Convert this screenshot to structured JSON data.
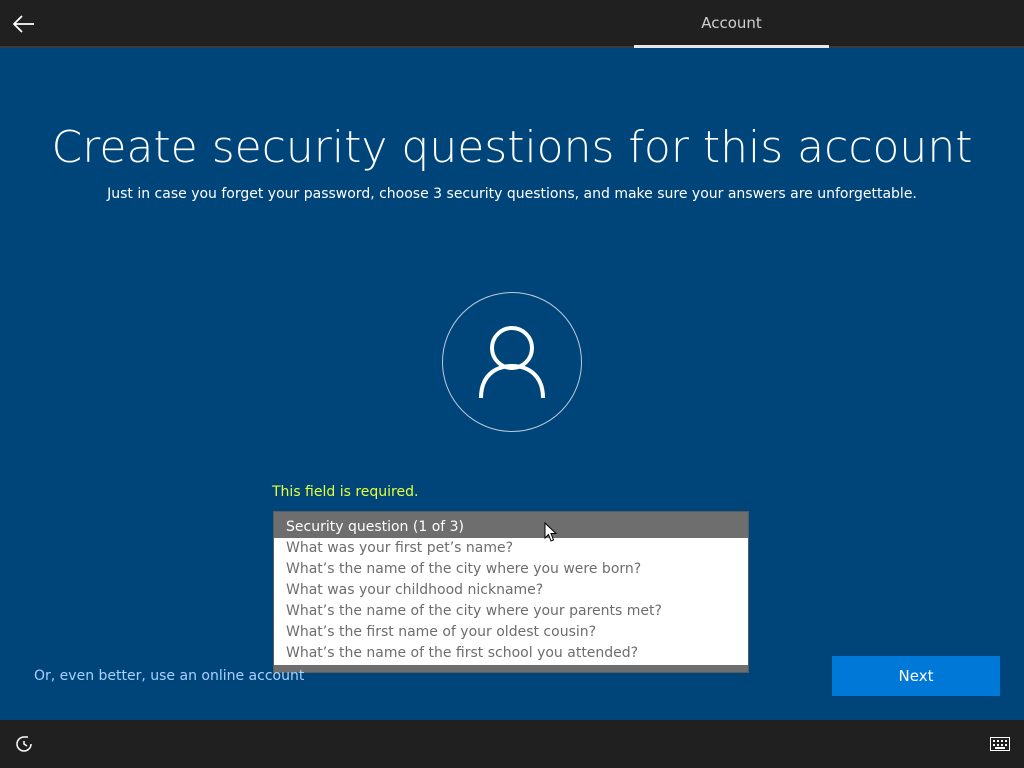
{
  "header": {
    "tab_label": "Account",
    "back_icon": "arrow-left-icon"
  },
  "main": {
    "title": "Create security questions for this account",
    "subtitle": "Just in case you forget your password, choose 3 security questions, and make sure your answers are unforgettable.",
    "avatar_icon": "user-icon",
    "error_text": "This field is required.",
    "dropdown": {
      "selected": "Security question (1 of 3)",
      "options": [
        "What was your first pet’s name?",
        "What’s the name of the city where you were born?",
        "What was your childhood nickname?",
        "What’s the name of the city where your parents met?",
        "What’s the first name of your oldest cousin?",
        "What’s the name of the first school you attended?"
      ]
    }
  },
  "footer": {
    "online_account_link": "Or, even better, use an online account",
    "next_label": "Next",
    "ease_icon": "ease-of-access-icon",
    "keyboard_icon": "keyboard-icon"
  },
  "colors": {
    "background": "#00457a",
    "bar": "#202020",
    "accent": "#0078d7",
    "error": "#e6ff3a",
    "link": "#a8d1ff"
  }
}
